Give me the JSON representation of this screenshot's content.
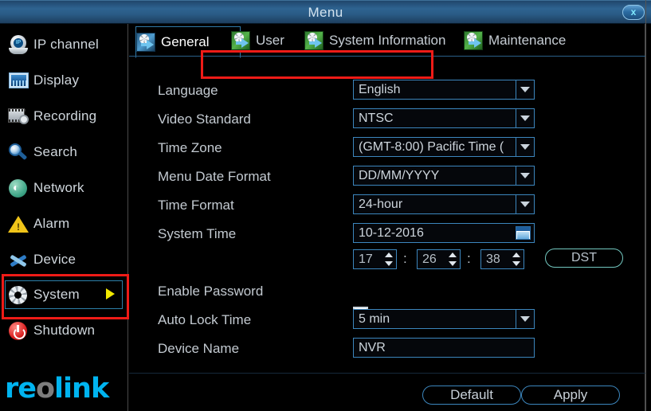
{
  "window": {
    "title": "Menu",
    "close_label": "x",
    "close_icon": "close-icon"
  },
  "sidebar": {
    "logo_pre": "re",
    "logo_o": "o",
    "logo_post": "link",
    "items": [
      {
        "label": "IP channel",
        "icon": "ip-camera-icon",
        "selected": false
      },
      {
        "label": "Display",
        "icon": "display-icon",
        "selected": false
      },
      {
        "label": "Recording",
        "icon": "recording-icon",
        "selected": false
      },
      {
        "label": "Search",
        "icon": "search-icon",
        "selected": false
      },
      {
        "label": "Network",
        "icon": "network-icon",
        "selected": false
      },
      {
        "label": "Alarm",
        "icon": "alarm-icon",
        "selected": false
      },
      {
        "label": "Device",
        "icon": "device-icon",
        "selected": false
      },
      {
        "label": "System",
        "icon": "gear-icon",
        "selected": true
      },
      {
        "label": "Shutdown",
        "icon": "power-icon",
        "selected": false
      }
    ]
  },
  "tabs": [
    {
      "label": "General",
      "active": true
    },
    {
      "label": "User",
      "active": false
    },
    {
      "label": "System Information",
      "active": false
    },
    {
      "label": "Maintenance",
      "active": false
    }
  ],
  "form": {
    "language": {
      "label": "Language",
      "value": "English"
    },
    "video_standard": {
      "label": "Video Standard",
      "value": "NTSC"
    },
    "time_zone": {
      "label": "Time Zone",
      "value": "(GMT-8:00) Pacific Time ("
    },
    "menu_date_format": {
      "label": "Menu Date Format",
      "value": "DD/MM/YYYY"
    },
    "time_format": {
      "label": "Time Format",
      "value": "24-hour"
    },
    "system_time": {
      "label": "System Time",
      "value": "10-12-2016",
      "calendar_icon": "calendar-icon",
      "dst_label": "DST",
      "hour": "17",
      "minute": "26",
      "second": "38",
      "separator": ":"
    },
    "enable_password": {
      "label": "Enable Password",
      "checked": true
    },
    "auto_lock_time": {
      "label": "Auto Lock Time",
      "value": "5 min"
    },
    "device_name": {
      "label": "Device Name",
      "value": "NVR"
    }
  },
  "footer": {
    "default_label": "Default",
    "apply_label": "Apply"
  },
  "colors": {
    "accent": "#3c86bd",
    "highlight_red": "#ee1b17",
    "logo_cyan": "#00b4f0",
    "arrow_yellow": "#f2e900"
  }
}
